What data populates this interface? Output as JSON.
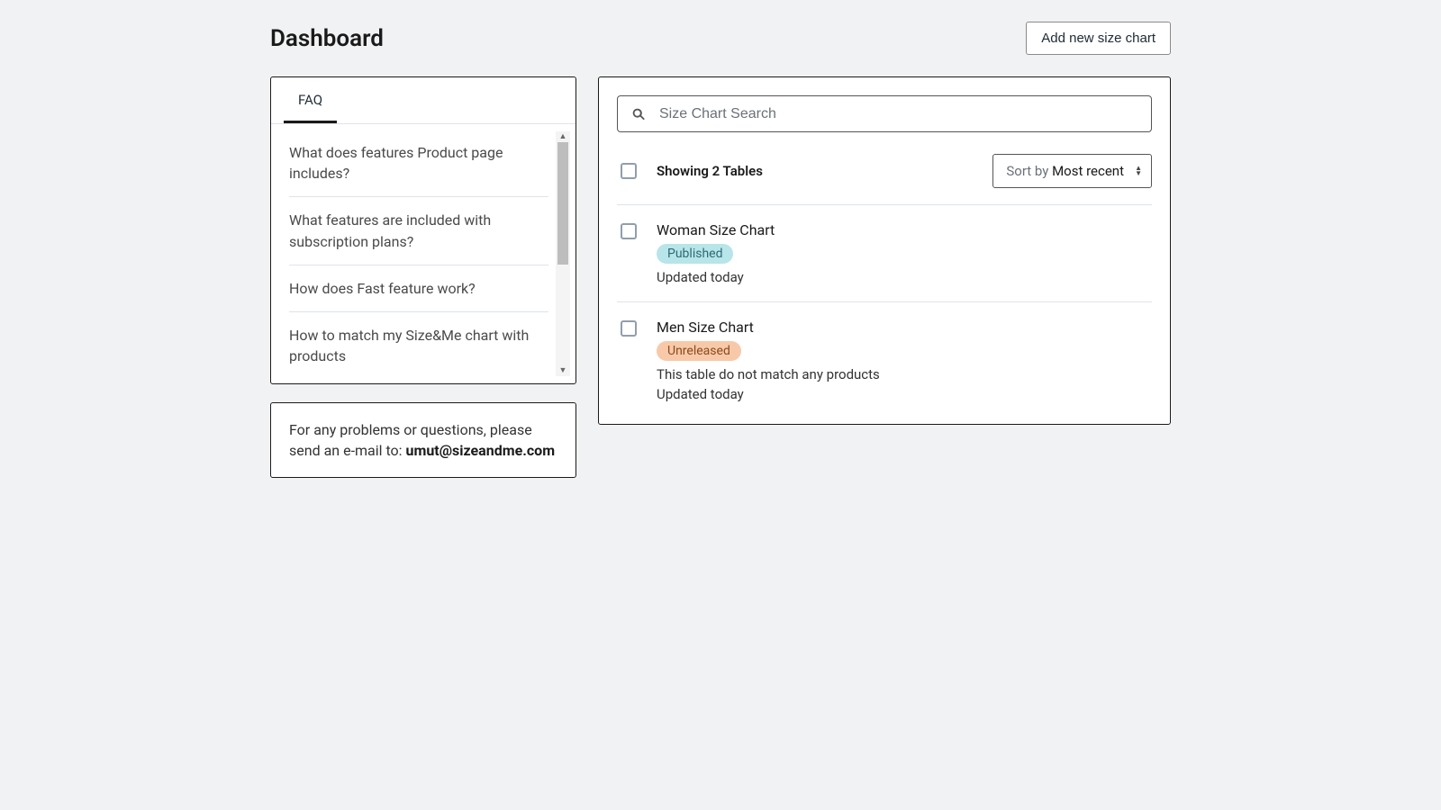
{
  "header": {
    "title": "Dashboard",
    "add_button": "Add new size chart"
  },
  "faq": {
    "tab_label": "FAQ",
    "items": [
      "What does features Product page includes?",
      "What features are included with subscription plans?",
      "How does Fast feature work?",
      "How to match my Size&Me chart with products"
    ]
  },
  "contact": {
    "prefix": "For any problems or questions, please send an e-mail to: ",
    "email": "umut@sizeandme.com"
  },
  "search": {
    "placeholder": "Size Chart Search"
  },
  "list": {
    "showing": "Showing 2 Tables",
    "sort_label": "Sort by ",
    "sort_value": "Most recent",
    "rows": [
      {
        "name": "Woman Size Chart",
        "status": "Published",
        "status_class": "badge-published",
        "note": "",
        "updated": "Updated today"
      },
      {
        "name": "Men Size Chart",
        "status": "Unreleased",
        "status_class": "badge-unreleased",
        "note": "This table do not match any products",
        "updated": "Updated today"
      }
    ]
  }
}
